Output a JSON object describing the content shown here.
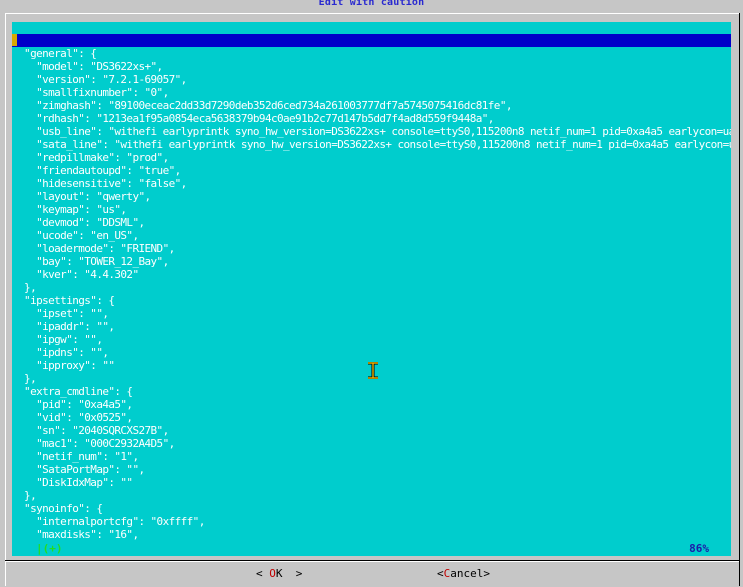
{
  "dialog": {
    "title": "Edit with caution"
  },
  "editor": {
    "lines": [
      "{",
      "  \"general\": {",
      "    \"model\": \"DS3622xs+\",",
      "    \"version\": \"7.2.1-69057\",",
      "    \"smallfixnumber\": \"0\",",
      "    \"zimghash\": \"89100eceac2dd33d7290deb352d6ced734a261003777df7a5745075416dc81fe\",",
      "    \"rdhash\": \"1213ea1f95a0854eca5638379b94c0ae91b2c77d147b5dd7f4ad8d559f9448a\",",
      "    \"usb_line\": \"withefi earlyprintk syno_hw_version=DS3622xs+ console=ttyS0,115200n8 netif_num=1 pid=0xa4a5 earlycon=uart8250,io,0x3f8,115200n8\",",
      "    \"sata_line\": \"withefi earlyprintk syno_hw_version=DS3622xs+ console=ttyS0,115200n8 netif_num=1 pid=0xa4a5 earlycon=uart8250,io,0x3f8,115200n8\",",
      "    \"redpillmake\": \"prod\",",
      "    \"friendautoupd\": \"true\",",
      "    \"hidesensitive\": \"false\",",
      "    \"layout\": \"qwerty\",",
      "    \"keymap\": \"us\",",
      "    \"devmod\": \"DDSML\",",
      "    \"ucode\": \"en_US\",",
      "    \"loadermode\": \"FRIEND\",",
      "    \"bay\": \"TOWER_12_Bay\",",
      "    \"kver\": \"4.4.302\"",
      "  },",
      "  \"ipsettings\": {",
      "    \"ipset\": \"\",",
      "    \"ipaddr\": \"\",",
      "    \"ipgw\": \"\",",
      "    \"ipdns\": \"\",",
      "    \"ipproxy\": \"\"",
      "  },",
      "  \"extra_cmdline\": {",
      "    \"pid\": \"0xa4a5\",",
      "    \"vid\": \"0x0525\",",
      "    \"sn\": \"2040SQRCXS27B\",",
      "    \"mac1\": \"000C2932A4D5\",",
      "    \"netif_num\": \"1\",",
      "    \"SataPortMap\": \"\",",
      "    \"DiskIdxMap\": \"\"",
      "  },",
      "  \"synoinfo\": {",
      "    \"internalportcfg\": \"0xffff\",",
      "    \"maxdisks\": \"16\","
    ],
    "cursor_line_index": 0
  },
  "status": {
    "scroll_indicator": "|(+)",
    "percent": "86%"
  },
  "buttons": {
    "ok_prefix": "< ",
    "ok_hot": "O",
    "ok_rest": "K",
    "ok_suffix": "  >",
    "cancel_prefix": "<",
    "cancel_hot": "C",
    "cancel_rest": "ancel",
    "cancel_suffix": ">"
  },
  "icons": {
    "text_cursor": "i-beam-cursor-icon"
  },
  "colors": {
    "editor_background": "#00cdcd",
    "editor_text": "#ffffff",
    "current_line": "#0000c8",
    "caret": "#d8a800",
    "title": "#2a2ad0",
    "hotkey": "#c00000",
    "dialog_background": "#c6c6c6"
  }
}
